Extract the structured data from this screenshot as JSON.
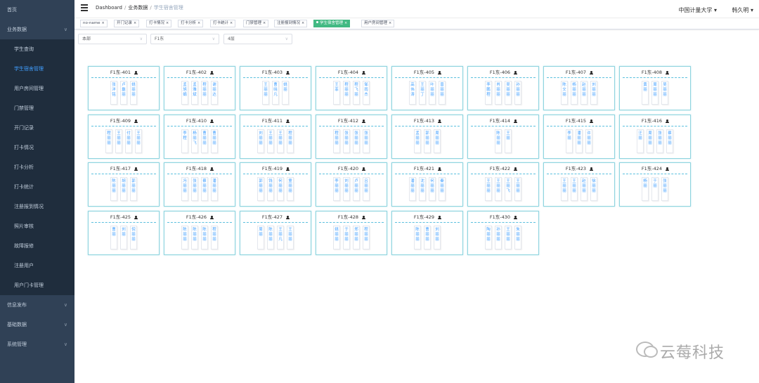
{
  "sidebar": {
    "items": [
      {
        "label": "首页",
        "sub": false,
        "active": false,
        "chevron": false
      },
      {
        "label": "业务数据",
        "sub": false,
        "active": false,
        "chevron": true
      },
      {
        "label": "学生查询",
        "sub": true,
        "active": false,
        "chevron": false
      },
      {
        "label": "学生宿舍管理",
        "sub": true,
        "active": true,
        "chevron": false
      },
      {
        "label": "用户房间管理",
        "sub": true,
        "active": false,
        "chevron": false
      },
      {
        "label": "门禁管理",
        "sub": true,
        "active": false,
        "chevron": false
      },
      {
        "label": "开门记录",
        "sub": true,
        "active": false,
        "chevron": false
      },
      {
        "label": "打卡情况",
        "sub": true,
        "active": false,
        "chevron": false
      },
      {
        "label": "打卡分析",
        "sub": true,
        "active": false,
        "chevron": false
      },
      {
        "label": "打卡统计",
        "sub": true,
        "active": false,
        "chevron": false
      },
      {
        "label": "注册报到情况",
        "sub": true,
        "active": false,
        "chevron": false
      },
      {
        "label": "照片审核",
        "sub": true,
        "active": false,
        "chevron": false
      },
      {
        "label": "故障报修",
        "sub": true,
        "active": false,
        "chevron": false
      },
      {
        "label": "注册用户",
        "sub": true,
        "active": false,
        "chevron": false
      },
      {
        "label": "用户门卡管理",
        "sub": true,
        "active": false,
        "chevron": false
      },
      {
        "label": "信息发布",
        "sub": false,
        "active": false,
        "chevron": true
      },
      {
        "label": "基础数据",
        "sub": false,
        "active": false,
        "chevron": true
      },
      {
        "label": "系统管理",
        "sub": false,
        "active": false,
        "chevron": true
      }
    ]
  },
  "header": {
    "breadcrumb": [
      "Dashboard",
      "业务数据",
      "学生宿舍管理"
    ],
    "org": "中国计量大学",
    "user": "韩久明"
  },
  "tags": [
    "no-name",
    "开门记录",
    "打卡情况",
    "打卡分析",
    "打卡统计",
    "门禁管理",
    "注册报到情况",
    "学生宿舍管理",
    "用户房间管理"
  ],
  "filters": {
    "campus": "本部",
    "building": "F1东",
    "floor": "4层"
  },
  "rooms": [
    {
      "name": "F1东-401",
      "beds": [
        "张洋铭",
        "卢磊丽",
        "姚丽丽",
        ""
      ]
    },
    {
      "name": "F1东-402",
      "beds": [
        "孟旭娟",
        "孟雅斌",
        "程丽丽",
        "谢丽达"
      ]
    },
    {
      "name": "F1东-403",
      "beds": [
        "王丽丽",
        "曹晓凡",
        "姚丽",
        ""
      ]
    },
    {
      "name": "F1东-404",
      "beds": [
        "王菲",
        "程丽丽",
        "程飞丽",
        "邹雨杰"
      ]
    },
    {
      "name": "F1东-405",
      "beds": [
        "高伟涛",
        "王丽丁",
        "叶丽丽",
        "曾丽丽"
      ]
    },
    {
      "name": "F1东-406",
      "beds": [
        "李鹏程",
        "肖丽丽",
        "吴丽丽",
        "孙丽丽"
      ]
    },
    {
      "name": "F1东-407",
      "beds": [
        "陈文丽",
        "杨丽丽",
        "赵丽丽",
        "刘丽丽"
      ]
    },
    {
      "name": "F1东-408",
      "beds": [
        "黄丽",
        "周丽丽",
        "吴丽丽",
        ""
      ]
    },
    {
      "name": "F1东-409",
      "beds": [
        "程丽丽",
        "王丽丽",
        "付丽丽",
        "王丽丽"
      ]
    },
    {
      "name": "F1东-410",
      "beds": [
        "李程",
        "杨丽飞",
        "曹丽丽",
        "曹丽丽"
      ]
    },
    {
      "name": "F1东-411",
      "beds": [
        "刘丽丽",
        "王丽丽",
        "王丽丽",
        "程丽丽"
      ]
    },
    {
      "name": "F1东-412",
      "beds": [
        "程丽丽",
        "张丽丽",
        "张丽丽",
        "张丽丽"
      ]
    },
    {
      "name": "F1东-413",
      "beds": [
        "孟丽丽",
        "郭丽丽",
        "周丽丽",
        ""
      ]
    },
    {
      "name": "F1东-414",
      "beds": [
        "",
        "陈丽丽",
        "王丽",
        ""
      ]
    },
    {
      "name": "F1东-415",
      "beds": [
        "李丽",
        "潘丽丽",
        "许丽丽",
        ""
      ]
    },
    {
      "name": "F1东-416",
      "beds": [
        "汪丽",
        "周丽丽",
        "张丽丽",
        "蔡丽丽"
      ]
    },
    {
      "name": "F1东-417",
      "beds": [
        "陈丽丽",
        "胡丽丽",
        "郭丽丽",
        ""
      ]
    },
    {
      "name": "F1东-418",
      "beds": [
        "冯丽丽",
        "张丽丽",
        "蔡丽丽",
        "潘丽丽"
      ]
    },
    {
      "name": "F1东-419",
      "beds": [
        "郭丽丽",
        "钱丽丽",
        "何丽丽",
        "童丽丽"
      ]
    },
    {
      "name": "F1东-420",
      "beds": [
        "李丽丽",
        "刘丽丽",
        "卢丽丽",
        "吕丽丽"
      ]
    },
    {
      "name": "F1东-421",
      "beds": [
        "潘丽丽",
        "沈丽丽",
        "何丽丽",
        "秦丽丽"
      ]
    },
    {
      "name": "F1东-422",
      "beds": [
        "王丽丽",
        "王丽丽",
        "王丽飞",
        "王丽丽"
      ]
    },
    {
      "name": "F1东-423",
      "beds": [
        "王丽丽",
        "王丽丽",
        "赵丽丽",
        "徐丽丽"
      ]
    },
    {
      "name": "F1东-424",
      "beds": [
        "杨丽",
        "于丽",
        "张丽丽",
        ""
      ]
    },
    {
      "name": "F1东-425",
      "beds": [
        "",
        "曹丽",
        "刘丽",
        "倪丽丽"
      ]
    },
    {
      "name": "F1东-426",
      "beds": [
        "陈丽丽",
        "陈丽丽",
        "陈丽丽",
        "程丽丽"
      ]
    },
    {
      "name": "F1东-427",
      "beds": [
        "周丽",
        "陈丽丽",
        "王丽凡",
        "王丽丽"
      ]
    },
    {
      "name": "F1东-428",
      "beds": [
        "姚丽丽",
        "于丽丽",
        "郑丽丽",
        "程丽丽"
      ]
    },
    {
      "name": "F1东-429",
      "beds": [
        "",
        "陈丽丽",
        "曹丽丽",
        "刘丽丽"
      ]
    },
    {
      "name": "F1东-430",
      "beds": [
        "陶丽丽",
        "孙丽丽",
        "王丽丽",
        "朱丽丽"
      ]
    }
  ],
  "watermark": {
    "text": "云莓科技",
    "icon": "wechat-icon"
  }
}
